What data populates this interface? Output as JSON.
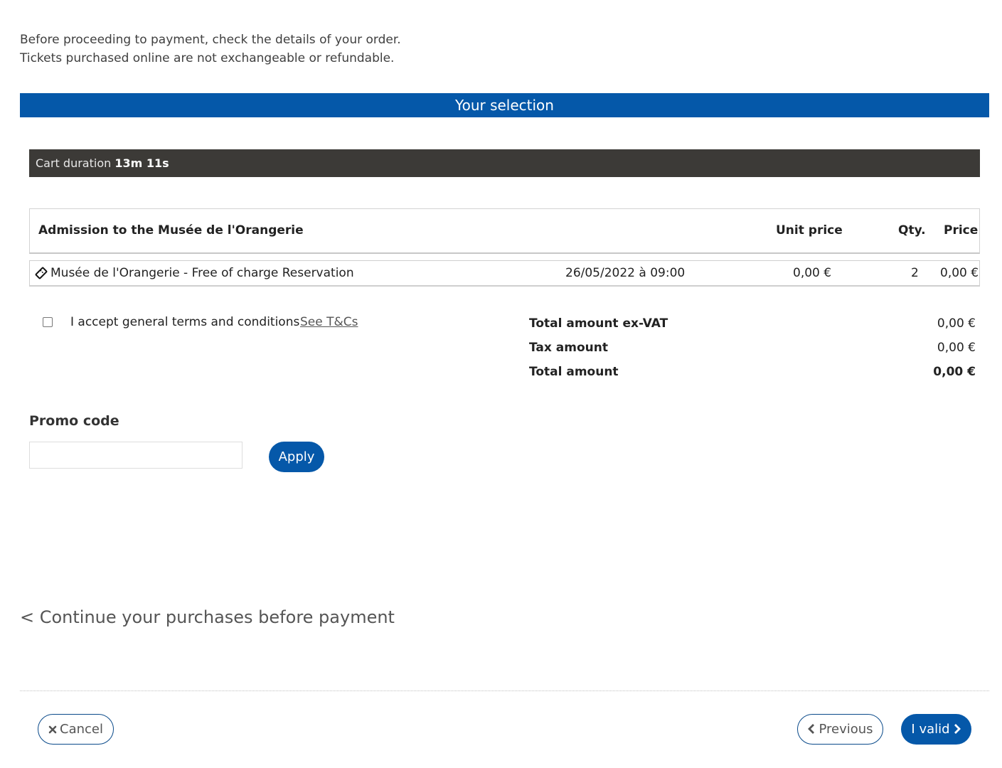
{
  "intro": {
    "line1": "Before proceeding to payment, check the details of your order.",
    "line2": "Tickets purchased online are not exchangeable or refundable."
  },
  "selection_banner": "Your selection",
  "cart": {
    "duration_label": "Cart duration",
    "duration_value": "13m 11s"
  },
  "ticket_table": {
    "title": "Admission to the Musée de l'Orangerie",
    "columns": {
      "unit_price": "Unit price",
      "qty": "Qty.",
      "price": "Price"
    },
    "rows": [
      {
        "icon": "ticket-icon",
        "name": "Musée de l'Orangerie - Free of charge Reservation",
        "date": "26/05/2022 à 09:00",
        "unit_price": "0,00 €",
        "qty": "2",
        "price": "0,00 €"
      }
    ]
  },
  "terms": {
    "label": "I accept general terms and conditions",
    "link": "See T&Cs",
    "checked": false
  },
  "totals": {
    "ex_vat_label": "Total amount ex-VAT",
    "ex_vat_value": "0,00 €",
    "tax_label": "Tax amount",
    "tax_value": "0,00 €",
    "total_label": "Total amount",
    "total_value": "0,00 €"
  },
  "promo": {
    "title": "Promo code",
    "input_value": "",
    "apply_label": "Apply"
  },
  "continue_link": "< Continue your purchases before payment",
  "footer": {
    "cancel_label": "Cancel",
    "cancel_icon": "close-icon",
    "previous_label": "Previous",
    "previous_icon": "chevron-left-icon",
    "valid_label": "I valid",
    "valid_icon": "chevron-right-icon"
  },
  "colors": {
    "primary": "#0558a9",
    "cart_bar": "#3c3a37"
  }
}
